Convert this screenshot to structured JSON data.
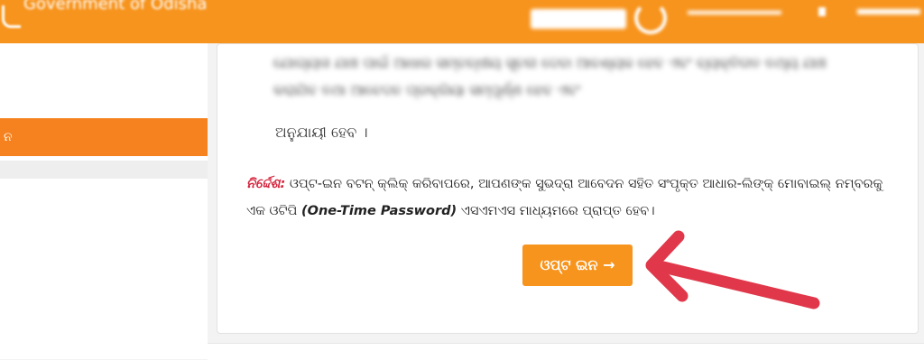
{
  "header": {
    "title": "Government of Odisha"
  },
  "sidebar": {
    "active_item_label": "ନ"
  },
  "main": {
    "blurred_paragraph": "ଯୋଗ୍ୟତା ଯାଞ୍ଚ ପାଇଁ ଆଧାର ସମ୍ବନ୍ଧୀୟ ସୂଚନା ଦେବା ଆବଶ୍ୟକ ହେବ ଏବଂ ବ୍ୟକ୍ତିଗତ ତଥ୍ୟ ଯାଞ୍ଚ କରାଯିବ ତଥା ଆବେଦନ ପ୍ରକ୍ରିୟା ସମ୍ପୂର୍ଣ୍ଣ ହେବ ଏବଂ",
    "fragment_text": "ଅନୁଯାୟୀ ହେବ ।",
    "note_label": "ନିର୍ଦ୍ଦେଶ:",
    "instruction_part1": " ଓପ୍ଟ-ଇନ ବଟନ୍ କ୍ଲିକ୍ କରିବାପରେ, ଆପଣଙ୍କ ସୁଭଦ୍ରା ଆବେଦନ ସହିତ ସଂପୃକ୍ତ ଆଧାର-ଲିଙ୍କ୍ ମୋବାଇଲ୍ ନମ୍ବରକୁ ଏକ ଓଟିପି ",
    "instruction_otp": "(One-Time Password)",
    "instruction_part2": " ଏସଏମଏସ ମାଧ୍ୟମରେ ପ୍ରାପ୍ତ ହେବ।",
    "opt_in_button": "ଓପ୍ଟ ଇନ →"
  },
  "colors": {
    "brand_orange": "#f7941d",
    "note_red": "#d3213a",
    "arrow_red": "#e0384a"
  }
}
